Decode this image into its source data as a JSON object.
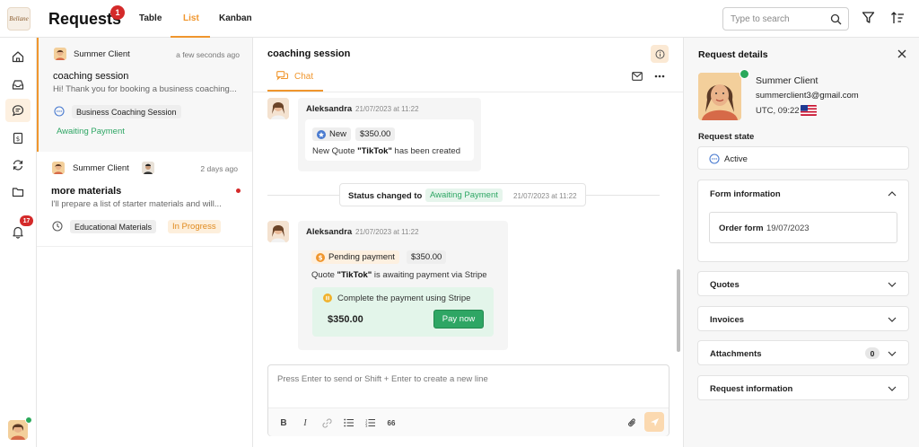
{
  "header": {
    "logo_text": "Bellane",
    "title": "Requests",
    "title_badge": "1",
    "tabs": [
      {
        "label": "Table",
        "active": false
      },
      {
        "label": "List",
        "active": true
      },
      {
        "label": "Kanban",
        "active": false
      }
    ],
    "search_placeholder": "Type to search",
    "icons": [
      "search-icon",
      "filter-icon",
      "sort-icon"
    ]
  },
  "rail": {
    "items": [
      "home-icon",
      "inbox-icon",
      "chat-icon",
      "invoice-icon",
      "sync-icon",
      "folder-icon",
      "bell-icon"
    ],
    "active_item": "chat-icon",
    "notifications_badge": "17"
  },
  "list": {
    "cards": [
      {
        "client": "Summer Client",
        "time": "a few seconds ago",
        "title": "coaching session",
        "preview": "Hi! Thank you for booking a business coaching...",
        "tag": "Business Coaching Session",
        "status": "Awaiting Payment",
        "selected": true
      },
      {
        "client": "Summer Client",
        "time": "2 days ago",
        "title": "more materials",
        "preview": "I'll prepare a list of starter materials and will...",
        "tag": "Educational Materials",
        "status": "In Progress",
        "unread": true
      }
    ]
  },
  "chat": {
    "title": "coaching session",
    "tab_label": "Chat",
    "messages": [
      {
        "sender": "Aleksandra",
        "time": "21/07/2023 at 11:22",
        "badge": "New",
        "amount": "$350.00",
        "text_pre": "New Quote ",
        "text_bold": "\"TikTok\"",
        "text_post": " has been created"
      },
      {
        "sender": "Aleksandra",
        "time": "21/07/2023 at 11:22",
        "badge": "Pending payment",
        "amount": "$350.00",
        "text_pre": "Quote ",
        "text_bold": "\"TikTok\"",
        "text_post": " is awaiting payment via Stripe",
        "pay_prompt": "Complete the payment using Stripe",
        "pay_amount": "$350.00",
        "pay_button": "Pay now"
      }
    ],
    "status_change": {
      "label": "Status changed to",
      "status": "Awaiting Payment",
      "time": "21/07/2023 at 11:22"
    },
    "composer_placeholder": "Press Enter to send or Shift + Enter to create a new line",
    "toolbar": {
      "bold": "B",
      "italic": "I",
      "quote": "66"
    }
  },
  "details": {
    "title": "Request details",
    "client_name": "Summer Client",
    "client_email": "summerclient3@gmail.com",
    "client_tz": "UTC, 09:22",
    "request_state_label": "Request state",
    "request_state": "Active",
    "form_info_title": "Form information",
    "order_form_label": "Order form",
    "order_form_date": "19/07/2023",
    "sections": [
      "Quotes",
      "Invoices",
      "Attachments",
      "Request information"
    ],
    "attachments_count": "0"
  },
  "colors": {
    "accent": "#f0962d",
    "green": "#2ea664",
    "red": "#d42a2a"
  }
}
